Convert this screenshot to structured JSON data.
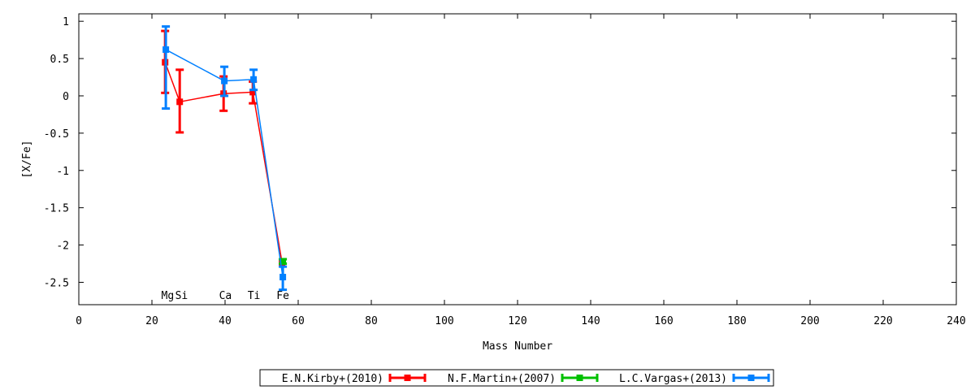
{
  "chart_data": {
    "type": "line",
    "xlabel": "Mass Number",
    "ylabel": "[X/Fe]",
    "xlim": [
      0,
      240
    ],
    "ylim": [
      -2.8,
      1.1
    ],
    "xticks": [
      0,
      20,
      40,
      60,
      80,
      100,
      120,
      140,
      160,
      180,
      200,
      220,
      240
    ],
    "yticks": [
      1,
      0.5,
      0,
      -0.5,
      -1,
      -1.5,
      -2,
      -2.5
    ],
    "grid": false,
    "legend_position": "bottom-center",
    "element_labels": [
      {
        "text": "Mg",
        "x": 24.3
      },
      {
        "text": "Si",
        "x": 28.1
      },
      {
        "text": "Ca",
        "x": 40.1
      },
      {
        "text": "Ti",
        "x": 47.9
      },
      {
        "text": "Fe",
        "x": 55.8
      }
    ],
    "series": [
      {
        "name": "E.N.Kirby+(2010)",
        "color": "#ff0000",
        "points": [
          {
            "x": 23.6,
            "y": 0.45,
            "err_lo": 0.41,
            "err_hi": 0.42
          },
          {
            "x": 27.6,
            "y": -0.08,
            "err_lo": 0.41,
            "err_hi": 0.43
          },
          {
            "x": 39.6,
            "y": 0.03,
            "err_lo": 0.23,
            "err_hi": 0.23
          },
          {
            "x": 47.6,
            "y": 0.05,
            "err_lo": 0.15,
            "err_hi": 0.14
          },
          {
            "x": 55.6,
            "y": -2.24,
            "err_lo": 0.0,
            "err_hi": 0.0
          }
        ]
      },
      {
        "name": "N.F.Martin+(2007)",
        "color": "#00c000",
        "points": [
          {
            "x": 55.8,
            "y": -2.22,
            "err_lo": 0.03,
            "err_hi": 0.03
          }
        ]
      },
      {
        "name": "L.C.Vargas+(2013)",
        "color": "#0080ff",
        "points": [
          {
            "x": 23.8,
            "y": 0.62,
            "err_lo": 0.79,
            "err_hi": 0.31
          },
          {
            "x": 39.8,
            "y": 0.2,
            "err_lo": 0.2,
            "err_hi": 0.19
          },
          {
            "x": 47.8,
            "y": 0.22,
            "err_lo": 0.14,
            "err_hi": 0.13
          },
          {
            "x": 55.8,
            "y": -2.43,
            "err_lo": 0.17,
            "err_hi": 0.14
          }
        ]
      }
    ]
  }
}
